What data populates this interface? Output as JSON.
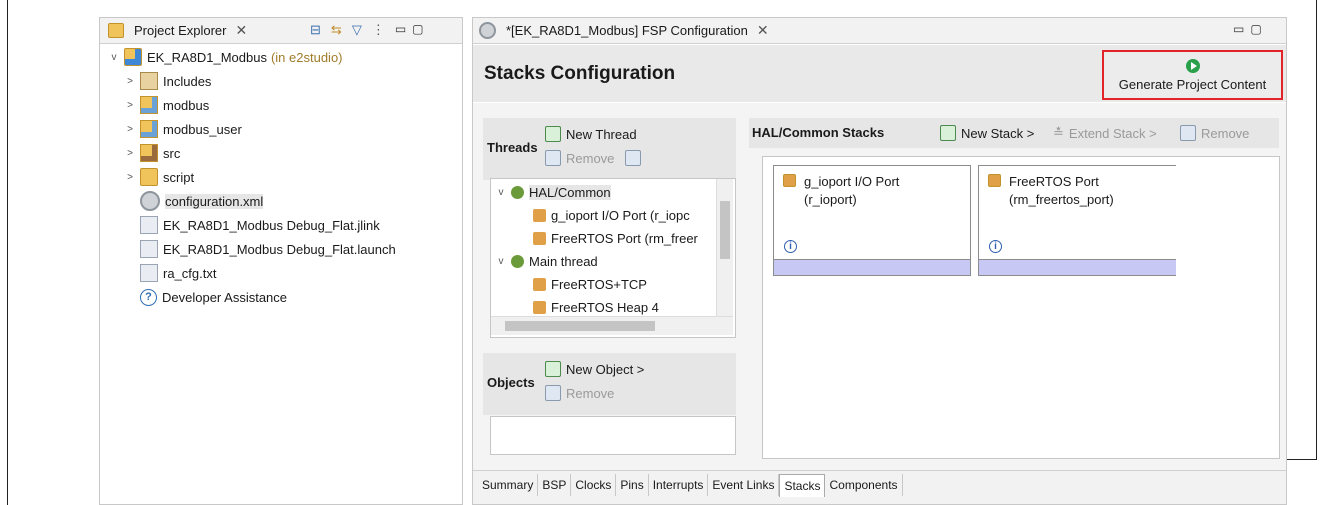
{
  "project_explorer": {
    "tab_label": "Project Explorer",
    "project": {
      "name": "EK_RA8D1_Modbus",
      "suffix": "(in e2studio)"
    },
    "items": [
      {
        "label": "Includes",
        "icon": "includes-folder-icon",
        "expand": ">"
      },
      {
        "label": "modbus",
        "icon": "source-folder-icon",
        "expand": ">"
      },
      {
        "label": "modbus_user",
        "icon": "source-folder-icon",
        "expand": ">"
      },
      {
        "label": "src",
        "icon": "src-folder-icon",
        "expand": ">"
      },
      {
        "label": "script",
        "icon": "folder-icon",
        "expand": ">"
      },
      {
        "label": "configuration.xml",
        "icon": "config-file-icon",
        "selected": true
      },
      {
        "label": "EK_RA8D1_Modbus Debug_Flat.jlink",
        "icon": "file-icon"
      },
      {
        "label": "EK_RA8D1_Modbus Debug_Flat.launch",
        "icon": "launch-file-icon"
      },
      {
        "label": "ra_cfg.txt",
        "icon": "text-file-icon"
      },
      {
        "label": "Developer Assistance",
        "icon": "help-icon"
      }
    ]
  },
  "editor": {
    "tab_label": "*[EK_RA8D1_Modbus] FSP Configuration",
    "title": "Stacks Configuration",
    "generate_label": "Generate Project Content",
    "threads": {
      "label": "Threads",
      "new_thread": "New Thread",
      "remove": "Remove",
      "tree": [
        {
          "label": "HAL/Common",
          "level": 0,
          "expand": "v",
          "selected": true
        },
        {
          "label": "g_ioport I/O Port (r_iopc",
          "level": 1
        },
        {
          "label": "FreeRTOS Port (rm_freer",
          "level": 1
        },
        {
          "label": "Main thread",
          "level": 0,
          "expand": "v"
        },
        {
          "label": "FreeRTOS+TCP",
          "level": 1
        },
        {
          "label": "FreeRTOS Heap 4",
          "level": 1
        }
      ]
    },
    "objects": {
      "label": "Objects",
      "new_object": "New Object >",
      "remove": "Remove"
    },
    "hal_stacks": {
      "label": "HAL/Common Stacks",
      "new_stack": "New Stack >",
      "extend_stack": "Extend Stack >",
      "remove": "Remove",
      "cards": [
        {
          "line1": "g_ioport I/O Port",
          "line2": "(r_ioport)"
        },
        {
          "line1": "FreeRTOS Port",
          "line2": "(rm_freertos_port)"
        }
      ]
    },
    "bottom_tabs": [
      "Summary",
      "BSP",
      "Clocks",
      "Pins",
      "Interrupts",
      "Event Links",
      "Stacks",
      "Components"
    ],
    "active_bottom_tab": "Stacks"
  },
  "colors": {
    "highlight_border": "#e0242a",
    "stack_band": "#c8c8f4",
    "generate_icon": "#2aa04a"
  }
}
